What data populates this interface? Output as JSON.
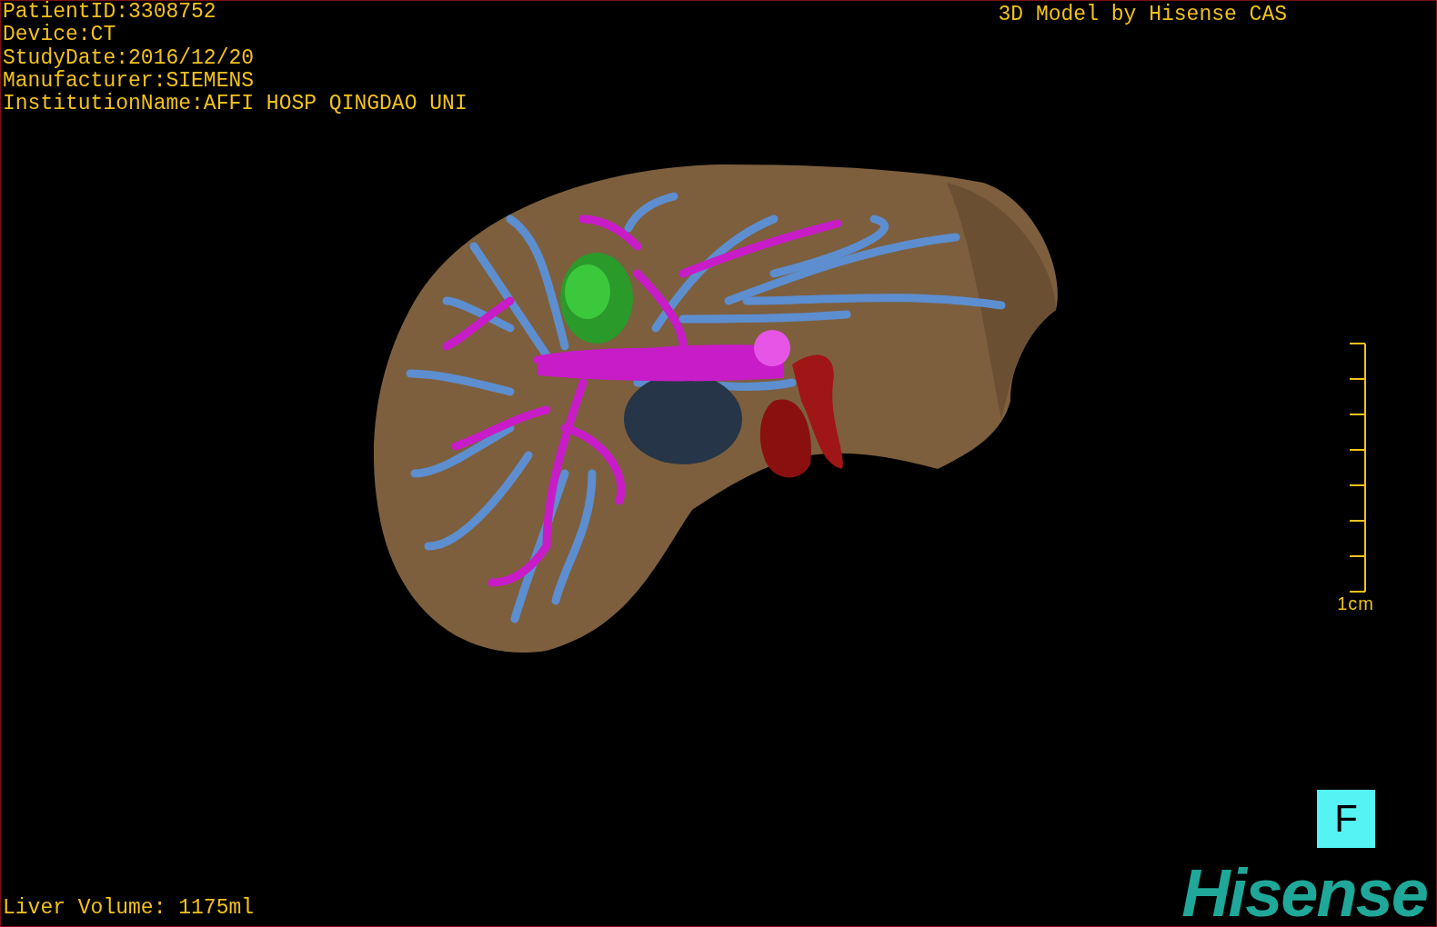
{
  "info_lines": [
    "PatientID:3308752",
    "Device:CT",
    "StudyDate:2016/12/20",
    "Manufacturer:SIEMENS",
    "InstitutionName:AFFI HOSP QINGDAO UNI"
  ],
  "title": "3D Model by Hisense CAS",
  "scale": {
    "label": "1cm"
  },
  "liver_volume": "Liver Volume: 1175ml",
  "view_button": "F",
  "logo": "Hisense"
}
